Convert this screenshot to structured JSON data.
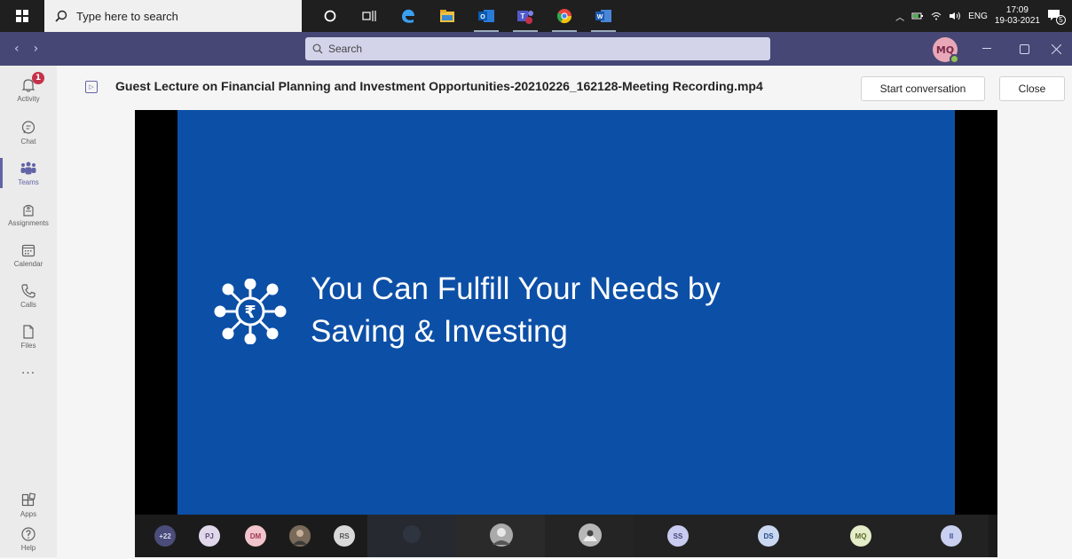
{
  "taskbar": {
    "search_placeholder": "Type here to search",
    "tray_lang": "ENG",
    "time": "17:09",
    "date": "19-03-2021",
    "notification_count": "5"
  },
  "titlebar": {
    "search_placeholder": "Search",
    "avatar_initials": "MQ"
  },
  "rail": {
    "items": [
      {
        "label": "Activity",
        "badge": "1"
      },
      {
        "label": "Chat"
      },
      {
        "label": "Teams"
      },
      {
        "label": "Assignments"
      },
      {
        "label": "Calendar"
      },
      {
        "label": "Calls"
      },
      {
        "label": "Files"
      },
      {
        "label": "···"
      },
      {
        "label": "Apps"
      },
      {
        "label": "Help"
      }
    ]
  },
  "header": {
    "file_name": "Guest Lecture on Financial Planning and Investment Opportunities-20210226_162128-Meeting Recording.mp4",
    "start_conversation": "Start conversation",
    "close": "Close"
  },
  "slide": {
    "line1": "You Can Fulfill Your Needs by",
    "line2": "Saving & Investing",
    "symbol": "₹"
  },
  "participants": [
    {
      "initials": "+22",
      "bg": "#4b4c7a",
      "fg": "#d8d8f0"
    },
    {
      "initials": "PJ",
      "bg": "#e0d8ea",
      "fg": "#5a4a7a"
    },
    {
      "initials": "DM",
      "bg": "#f2c4cc",
      "fg": "#a13a52"
    },
    {
      "initials": "RS",
      "bg": "#d9d9d9",
      "fg": "#555555"
    },
    {
      "initials": "SS",
      "bg": "#c9cbf0",
      "fg": "#464775"
    },
    {
      "initials": "DS",
      "bg": "#c9d8f0",
      "fg": "#2b4a8a"
    },
    {
      "initials": "MQ",
      "bg": "#e4ecc8",
      "fg": "#5a6a2a"
    },
    {
      "initials": "II",
      "bg": "#c9d0f0",
      "fg": "#3a4aa0"
    }
  ],
  "colors": {
    "teams_purple": "#464775",
    "accent": "#6264a7",
    "slide_blue": "#0c4fa6"
  }
}
